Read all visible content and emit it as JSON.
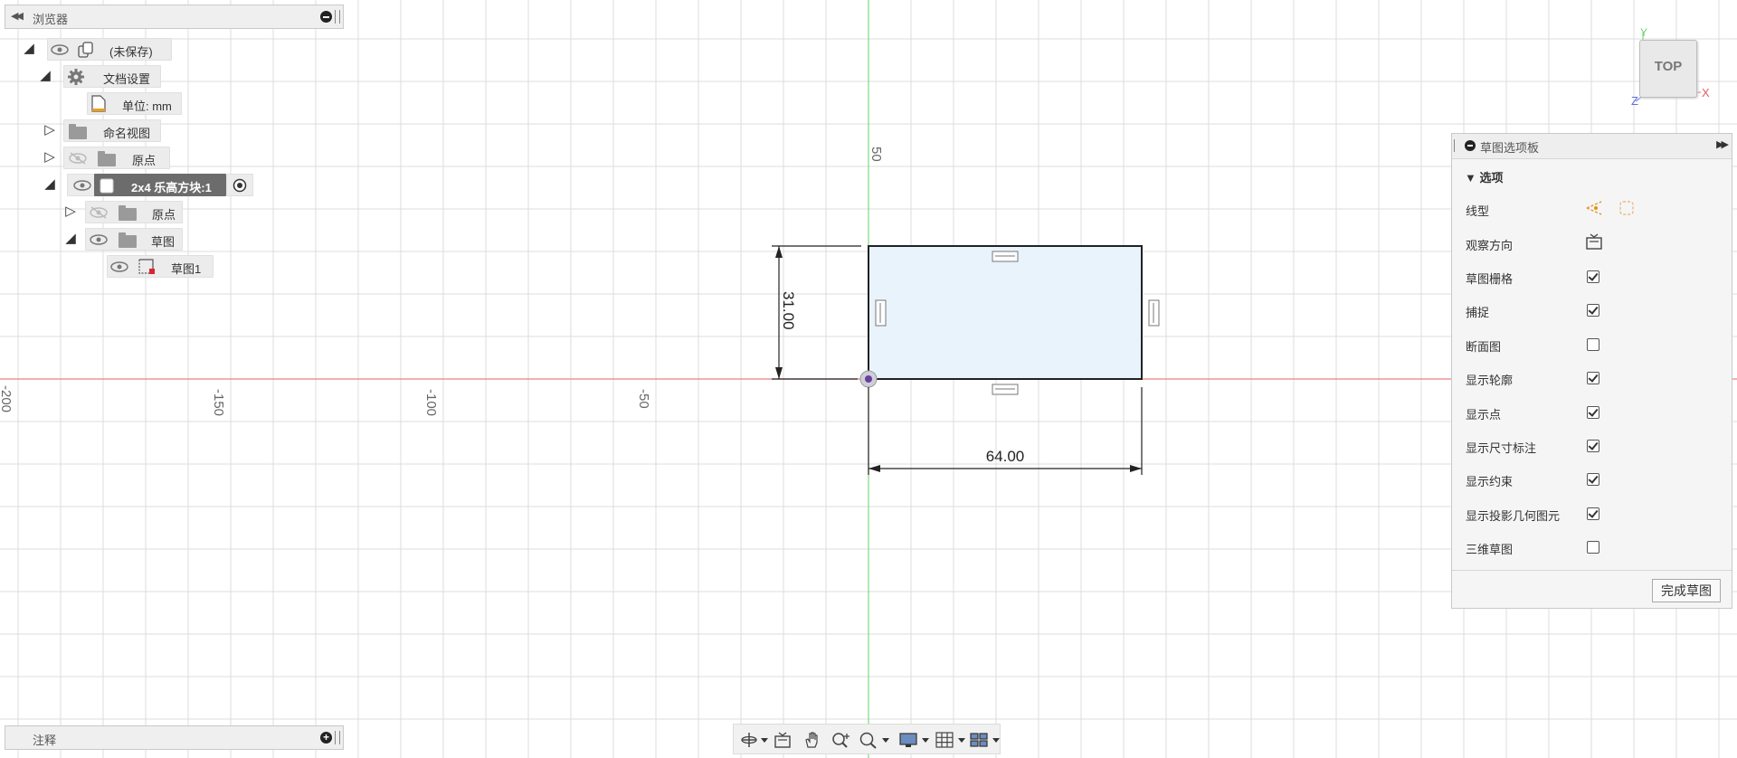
{
  "browser": {
    "title": "浏览器",
    "items": [
      {
        "label": "(未保存)"
      },
      {
        "label": "文档设置"
      },
      {
        "label": "单位: mm"
      },
      {
        "label": "命名视图"
      },
      {
        "label": "原点"
      },
      {
        "label": "2x4 乐高方块:1"
      },
      {
        "label": "原点"
      },
      {
        "label": "草图"
      },
      {
        "label": "草图1"
      }
    ]
  },
  "comments": {
    "title": "注释"
  },
  "canvas": {
    "axis_labels": [
      "50",
      "-200",
      "-150",
      "-100",
      "-50"
    ],
    "dimension_height": "31.00",
    "dimension_width": "64.00",
    "colors": {
      "x_axis": "#e88080",
      "y_axis": "#7fd97f",
      "sketch_fill": "#e8f3fc",
      "grid": "#dcdcdc"
    }
  },
  "viewcube": {
    "face": "TOP",
    "axis_x": "X",
    "axis_y": "Y",
    "axis_z": "Z"
  },
  "palette": {
    "title": "草图选项板",
    "section": "选项",
    "options": [
      {
        "label": "线型",
        "type": "icons"
      },
      {
        "label": "观察方向",
        "type": "icon"
      },
      {
        "label": "草图栅格",
        "checked": true
      },
      {
        "label": "捕捉",
        "checked": true
      },
      {
        "label": "断面图",
        "checked": false
      },
      {
        "label": "显示轮廓",
        "checked": true
      },
      {
        "label": "显示点",
        "checked": true
      },
      {
        "label": "显示尺寸标注",
        "checked": true
      },
      {
        "label": "显示约束",
        "checked": true
      },
      {
        "label": "显示投影几何图元",
        "checked": true
      },
      {
        "label": "三维草图",
        "checked": false
      }
    ],
    "finish_button": "完成草图"
  },
  "toolbar": {
    "icons": [
      "orbit-icon",
      "look-at-icon",
      "pan-icon",
      "zoom-icon",
      "zoom-window-icon",
      "display-settings-icon",
      "grid-settings-icon",
      "viewports-icon"
    ]
  }
}
